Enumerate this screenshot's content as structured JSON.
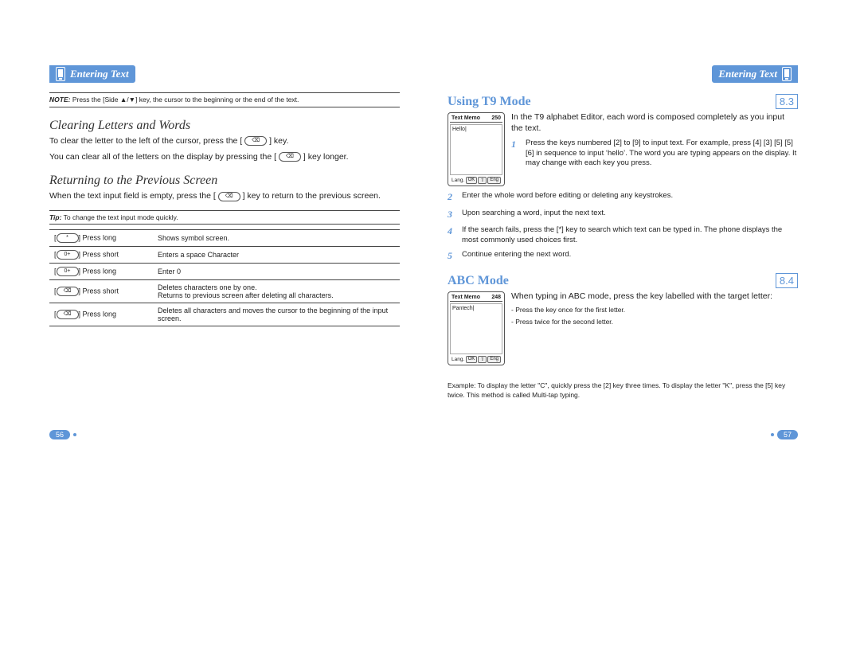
{
  "header": {
    "title": "Entering Text"
  },
  "left": {
    "note": {
      "label": "NOTE:",
      "text": "Press the [Side ▲/▼] key, the cursor to the beginning or the end of the text."
    },
    "s1": {
      "h": "Clearing Letters and Words",
      "p1a": "To clear the letter to the left of the cursor, press the [",
      "p1b": "] key.",
      "p2a": "You can clear all of the letters on the display by pressing the [",
      "p2b": "] key longer."
    },
    "s2": {
      "h": "Returning to the Previous Screen",
      "p1a": "When the text input field is empty, press the [",
      "p1b": "] key to return to the previous screen."
    },
    "tip": {
      "label": "Tip:",
      "text": "To change the text input mode quickly."
    },
    "tbl": [
      {
        "k": "*",
        "act": "Press long",
        "desc": "Shows symbol screen."
      },
      {
        "k": "0+",
        "act": "Press short",
        "desc": "Enters a space Character"
      },
      {
        "k": "0+",
        "act": "Press long",
        "desc": "Enter 0"
      },
      {
        "k": "C",
        "act": "Press short",
        "desc": "Deletes characters one by one.\nReturns to previous screen after deleting all characters."
      },
      {
        "k": "C",
        "act": "Press long",
        "desc": "Deletes all characters and moves the cursor to the beginning of the input screen."
      }
    ]
  },
  "right": {
    "s3": {
      "h": "Using T9 Mode",
      "num": "8.3",
      "memo": {
        "title": "Text Memo",
        "count": "250",
        "content": "Hello|",
        "lang": "Lang.",
        "ok": "OK",
        "mode": "Eng"
      },
      "intro": "In the T9 alphabet Editor, each word is composed completely as you input the text.",
      "steps": [
        "Press the keys numbered [2] to [9] to input text. For example, press [4] [3] [5] [5] [6] in sequence to input ‘hello’. The word you are typing appears on the display. It may change with each key you press.",
        "Enter the whole word before editing or deleting any keystrokes.",
        "Upon searching a word, input the next text.",
        "If the search fails, press the [*] key to search which text can be typed in. The phone displays the most commonly used choices first.",
        "Continue entering the next word."
      ]
    },
    "s4": {
      "h": "ABC Mode",
      "num": "8.4",
      "memo": {
        "title": "Text Memo",
        "count": "248",
        "content": "Pantech|",
        "lang": "Lang.",
        "ok": "OK",
        "mode": "Eng"
      },
      "intro": "When typing in ABC mode, press the key labelled with the target letter:",
      "bullets": [
        "- Press the key once for the first letter.",
        "- Press twice for the second letter."
      ],
      "example": "Example: To display the letter \"C\", quickly press the [2] key three times. To display the letter \"K\", press the [5] key twice. This method is called Multi-tap typing."
    }
  },
  "pages": {
    "left": "56",
    "right": "57"
  }
}
